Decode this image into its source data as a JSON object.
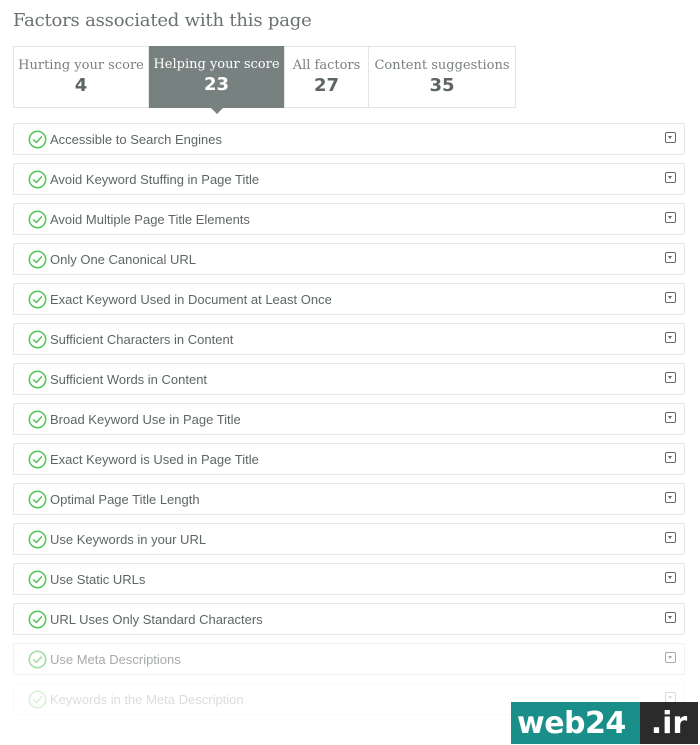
{
  "header": {
    "title": "Factors associated with this page"
  },
  "tabs": [
    {
      "label": "Hurting your score",
      "count": "4",
      "active": false
    },
    {
      "label": "Helping your score",
      "count": "23",
      "active": true
    },
    {
      "label": "All factors",
      "count": "27",
      "active": false
    },
    {
      "label": "Content suggestions",
      "count": "35",
      "active": false
    }
  ],
  "factors": [
    {
      "label": "Accessible to Search Engines",
      "status": "pass"
    },
    {
      "label": "Avoid Keyword Stuffing in Page Title",
      "status": "pass"
    },
    {
      "label": "Avoid Multiple Page Title Elements",
      "status": "pass"
    },
    {
      "label": "Only One Canonical URL",
      "status": "pass"
    },
    {
      "label": "Exact Keyword Used in Document at Least Once",
      "status": "pass"
    },
    {
      "label": "Sufficient Characters in Content",
      "status": "pass"
    },
    {
      "label": "Sufficient Words in Content",
      "status": "pass"
    },
    {
      "label": "Broad Keyword Use in Page Title",
      "status": "pass"
    },
    {
      "label": "Exact Keyword is Used in Page Title",
      "status": "pass"
    },
    {
      "label": "Optimal Page Title Length",
      "status": "pass"
    },
    {
      "label": "Use Keywords in your URL",
      "status": "pass"
    },
    {
      "label": "Use Static URLs",
      "status": "pass"
    },
    {
      "label": "URL Uses Only Standard Characters",
      "status": "pass"
    },
    {
      "label": "Use Meta Descriptions",
      "status": "pass"
    },
    {
      "label": "Keywords in the Meta Description",
      "status": "pass"
    }
  ],
  "icons": {
    "factor_status": "check-circle-icon",
    "expand": "chevron-down-icon"
  },
  "colors": {
    "pass_green": "#5cc45c",
    "active_tab": "#778180",
    "watermark_bg": "#1a8f8a"
  },
  "watermark": {
    "main": "web24",
    "tld": ".ir"
  }
}
